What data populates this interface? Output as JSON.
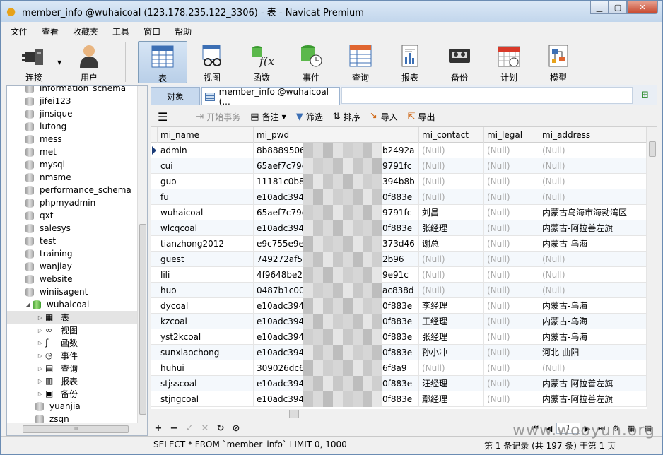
{
  "window": {
    "title": "member_info @wuhaicoal (123.178.235.122_3306) - 表 - Navicat Premium"
  },
  "menu": [
    "文件",
    "查看",
    "收藏夹",
    "工具",
    "窗口",
    "帮助"
  ],
  "toolbar": {
    "connect": "连接",
    "user": "用户",
    "table": "表",
    "view": "视图",
    "function": "函数",
    "event": "事件",
    "query": "查询",
    "report": "报表",
    "backup": "备份",
    "schedule": "计划",
    "model": "模型"
  },
  "sidebar": {
    "items": [
      "information_schema",
      "jifei123",
      "jinsique",
      "lutong",
      "mess",
      "met",
      "mysql",
      "nmsme",
      "performance_schema",
      "phpmyadmin",
      "qxt",
      "salesys",
      "test",
      "training",
      "wanjiay",
      "website",
      "winiisagent",
      "wuhaicoal"
    ],
    "children": [
      "表",
      "视图",
      "函数",
      "事件",
      "查询",
      "报表",
      "备份"
    ],
    "after": [
      "yuanjia",
      "zsqn"
    ],
    "scroll_label": "III"
  },
  "tabs": {
    "objects": "对象",
    "current": "member_info @wuhaicoal (..."
  },
  "gridtools": {
    "menu": "☰",
    "begin_tx": "开始事务",
    "note": "备注",
    "filter": "筛选",
    "sort": "排序",
    "import": "导入",
    "export": "导出"
  },
  "columns": [
    "mi_name",
    "mi_pwd",
    "mi_contact",
    "mi_legal",
    "mi_address"
  ],
  "rows": [
    {
      "name": "admin",
      "pwd_a": "8b8889506f",
      "pwd_b": "b2492a",
      "contact": "(Null)",
      "legal": "(Null)",
      "address": "(Null)"
    },
    {
      "name": "cui",
      "pwd_a": "65aef7c79e",
      "pwd_b": "9791fc",
      "contact": "(Null)",
      "legal": "(Null)",
      "address": "(Null)"
    },
    {
      "name": "guo",
      "pwd_a": "11181c0b85",
      "pwd_b": "394b8b",
      "contact": "(Null)",
      "legal": "(Null)",
      "address": "(Null)"
    },
    {
      "name": "fu",
      "pwd_a": "e10adc3949",
      "pwd_b": "0f883e",
      "contact": "(Null)",
      "legal": "(Null)",
      "address": "(Null)"
    },
    {
      "name": "wuhaicoal",
      "pwd_a": "65aef7c79e",
      "pwd_b": "9791fc",
      "contact": "刘昌",
      "legal": "(Null)",
      "address": "内蒙古乌海市海勃湾区"
    },
    {
      "name": "wlcqcoal",
      "pwd_a": "e10adc3949",
      "pwd_b": "0f883e",
      "contact": "张经理",
      "legal": "(Null)",
      "address": "内蒙古-阿拉善左旗"
    },
    {
      "name": "tianzhong2012",
      "pwd_a": "e9c755e9e0",
      "pwd_b": "373d46",
      "contact": "谢总",
      "legal": "(Null)",
      "address": "内蒙古-乌海"
    },
    {
      "name": "guest",
      "pwd_a": "749272af57",
      "pwd_b": "2b96",
      "contact": "(Null)",
      "legal": "(Null)",
      "address": "(Null)"
    },
    {
      "name": "lili",
      "pwd_a": "4f9648be27",
      "pwd_b": "9e91c",
      "contact": "(Null)",
      "legal": "(Null)",
      "address": "(Null)"
    },
    {
      "name": "huo",
      "pwd_a": "0487b1c007",
      "pwd_b": "ac838d",
      "contact": "(Null)",
      "legal": "(Null)",
      "address": "(Null)"
    },
    {
      "name": "dycoal",
      "pwd_a": "e10adc3949",
      "pwd_b": "0f883e",
      "contact": "李经理",
      "legal": "(Null)",
      "address": "内蒙古-乌海"
    },
    {
      "name": "kzcoal",
      "pwd_a": "e10adc3949",
      "pwd_b": "0f883e",
      "contact": "王经理",
      "legal": "(Null)",
      "address": "内蒙古-乌海"
    },
    {
      "name": "yst2kcoal",
      "pwd_a": "e10adc3949",
      "pwd_b": "0f883e",
      "contact": "张经理",
      "legal": "(Null)",
      "address": "内蒙古-乌海"
    },
    {
      "name": "sunxiaochong",
      "pwd_a": "e10adc3949",
      "pwd_b": "0f883e",
      "contact": "孙小冲",
      "legal": "(Null)",
      "address": "河北-曲阳"
    },
    {
      "name": "huhui",
      "pwd_a": "309026dc66",
      "pwd_b": "6f8a9",
      "contact": "(Null)",
      "legal": "(Null)",
      "address": "(Null)"
    },
    {
      "name": "stjsscoal",
      "pwd_a": "e10adc3949",
      "pwd_b": "0f883e",
      "contact": "汪经理",
      "legal": "(Null)",
      "address": "内蒙古-阿拉善左旗"
    },
    {
      "name": "stjngcoal",
      "pwd_a": "e10adc3949",
      "pwd_b": "0f883e",
      "contact": "鄢经理",
      "legal": "(Null)",
      "address": "内蒙古-阿拉善左旗"
    }
  ],
  "pager": {
    "page": "1"
  },
  "status": {
    "sql": "SELECT * FROM `member_info` LIMIT 0, 1000",
    "records": "第 1 条记录 (共 197 条) 于第 1 页"
  },
  "watermark": "www.wooyun.org"
}
